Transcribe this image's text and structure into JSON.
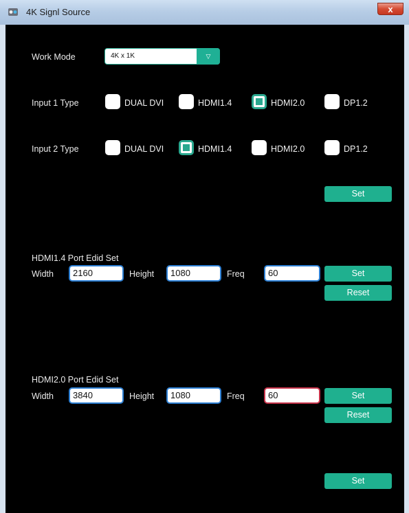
{
  "window": {
    "title": "4K Signl Source",
    "close_label": "x"
  },
  "work_mode": {
    "label": "Work Mode",
    "value": "4K x 1K",
    "arrow": "▽"
  },
  "input1": {
    "label": "Input 1 Type",
    "options": [
      {
        "label": "DUAL DVI",
        "checked": false
      },
      {
        "label": "HDMI1.4",
        "checked": false
      },
      {
        "label": "HDMI2.0",
        "checked": true
      },
      {
        "label": "DP1.2",
        "checked": false
      }
    ]
  },
  "input2": {
    "label": "Input 2 Type",
    "options": [
      {
        "label": "DUAL DVI",
        "checked": false
      },
      {
        "label": "HDMI1.4",
        "checked": true
      },
      {
        "label": "HDMI2.0",
        "checked": false
      },
      {
        "label": "DP1.2",
        "checked": false
      }
    ]
  },
  "type_set_label": "Set",
  "hdmi14": {
    "heading": "HDMI1.4 Port Edid Set",
    "width_label": "Width",
    "width_value": "2160",
    "height_label": "Height",
    "height_value": "1080",
    "freq_label": "Freq",
    "freq_value": "60",
    "set_label": "Set",
    "reset_label": "Reset"
  },
  "hdmi20": {
    "heading": "HDMI2.0 Port Edid Set",
    "width_label": "Width",
    "width_value": "3840",
    "height_label": "Height",
    "height_value": "1080",
    "freq_label": "Freq",
    "freq_value": "60",
    "set_label": "Set",
    "reset_label": "Reset"
  },
  "bottom_set_label": "Set",
  "colors": {
    "accent": "#1fb08f",
    "panel": "#000000",
    "field_border": "#2c7fd4",
    "field_error": "#c7334a"
  }
}
